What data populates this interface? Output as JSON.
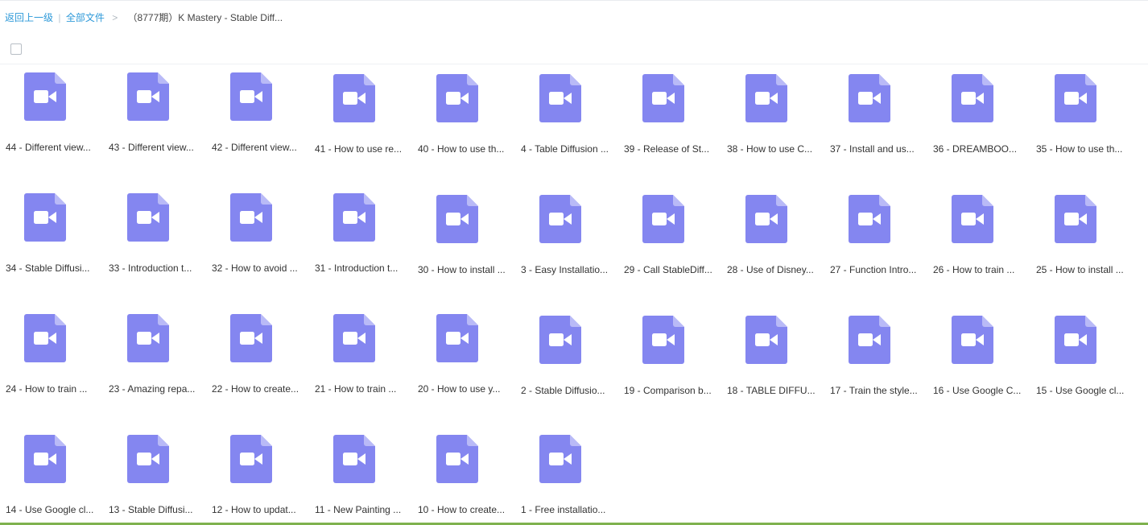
{
  "breadcrumb": {
    "back_label": "返回上一级",
    "separator": "|",
    "all_files_label": "全部文件",
    "arrow": ">",
    "current_folder": "（8777期）K Mastery - Stable Diff..."
  },
  "colors": {
    "icon_fill": "#8486f0",
    "icon_fold": "#b9baf7",
    "link": "#2f9ad9",
    "bottom_bar": "#7fb24e"
  },
  "files": [
    {
      "name": "44 - Different view...",
      "icon": "video-file-icon"
    },
    {
      "name": "43 - Different view...",
      "icon": "video-file-icon"
    },
    {
      "name": "42 - Different view...",
      "icon": "video-file-icon"
    },
    {
      "name": "41 - How to use re...",
      "icon": "video-file-icon"
    },
    {
      "name": "40 - How to use th...",
      "icon": "video-file-icon"
    },
    {
      "name": "4 - Table Diffusion ...",
      "icon": "video-file-icon"
    },
    {
      "name": "39 - Release of St...",
      "icon": "video-file-icon"
    },
    {
      "name": "38 - How to use C...",
      "icon": "video-file-icon"
    },
    {
      "name": "37 - Install and us...",
      "icon": "video-file-icon"
    },
    {
      "name": "36 - DREAMBOO...",
      "icon": "video-file-icon"
    },
    {
      "name": "35 - How to use th...",
      "icon": "video-file-icon"
    },
    {
      "name": "34 - Stable Diffusi...",
      "icon": "video-file-icon"
    },
    {
      "name": "33 - Introduction t...",
      "icon": "video-file-icon"
    },
    {
      "name": "32 - How to avoid ...",
      "icon": "video-file-icon"
    },
    {
      "name": "31 - Introduction t...",
      "icon": "video-file-icon"
    },
    {
      "name": "30 - How to install ...",
      "icon": "video-file-icon"
    },
    {
      "name": "3 - Easy Installatio...",
      "icon": "video-file-icon"
    },
    {
      "name": "29 - Call StableDiff...",
      "icon": "video-file-icon"
    },
    {
      "name": "28 - Use of Disney...",
      "icon": "video-file-icon"
    },
    {
      "name": "27 - Function Intro...",
      "icon": "video-file-icon"
    },
    {
      "name": "26 - How to train ...",
      "icon": "video-file-icon"
    },
    {
      "name": "25 - How to install ...",
      "icon": "video-file-icon"
    },
    {
      "name": "24 - How to train ...",
      "icon": "video-file-icon"
    },
    {
      "name": "23 - Amazing repa...",
      "icon": "video-file-icon"
    },
    {
      "name": "22 - How to create...",
      "icon": "video-file-icon"
    },
    {
      "name": "21 - How to train ...",
      "icon": "video-file-icon"
    },
    {
      "name": "20 - How to use y...",
      "icon": "video-file-icon"
    },
    {
      "name": "2 - Stable Diffusio...",
      "icon": "video-file-icon"
    },
    {
      "name": "19 - Comparison b...",
      "icon": "video-file-icon"
    },
    {
      "name": "18 - TABLE DIFFU...",
      "icon": "video-file-icon"
    },
    {
      "name": "17 - Train the style...",
      "icon": "video-file-icon"
    },
    {
      "name": "16 - Use Google C...",
      "icon": "video-file-icon"
    },
    {
      "name": "15 - Use Google cl...",
      "icon": "video-file-icon"
    },
    {
      "name": "14 - Use Google cl...",
      "icon": "video-file-icon"
    },
    {
      "name": "13 - Stable Diffusi...",
      "icon": "video-file-icon"
    },
    {
      "name": "12 - How to updat...",
      "icon": "video-file-icon"
    },
    {
      "name": "11 - New Painting ...",
      "icon": "video-file-icon"
    },
    {
      "name": "10 - How to create...",
      "icon": "video-file-icon"
    },
    {
      "name": "1 - Free installatio...",
      "icon": "video-file-icon"
    }
  ]
}
